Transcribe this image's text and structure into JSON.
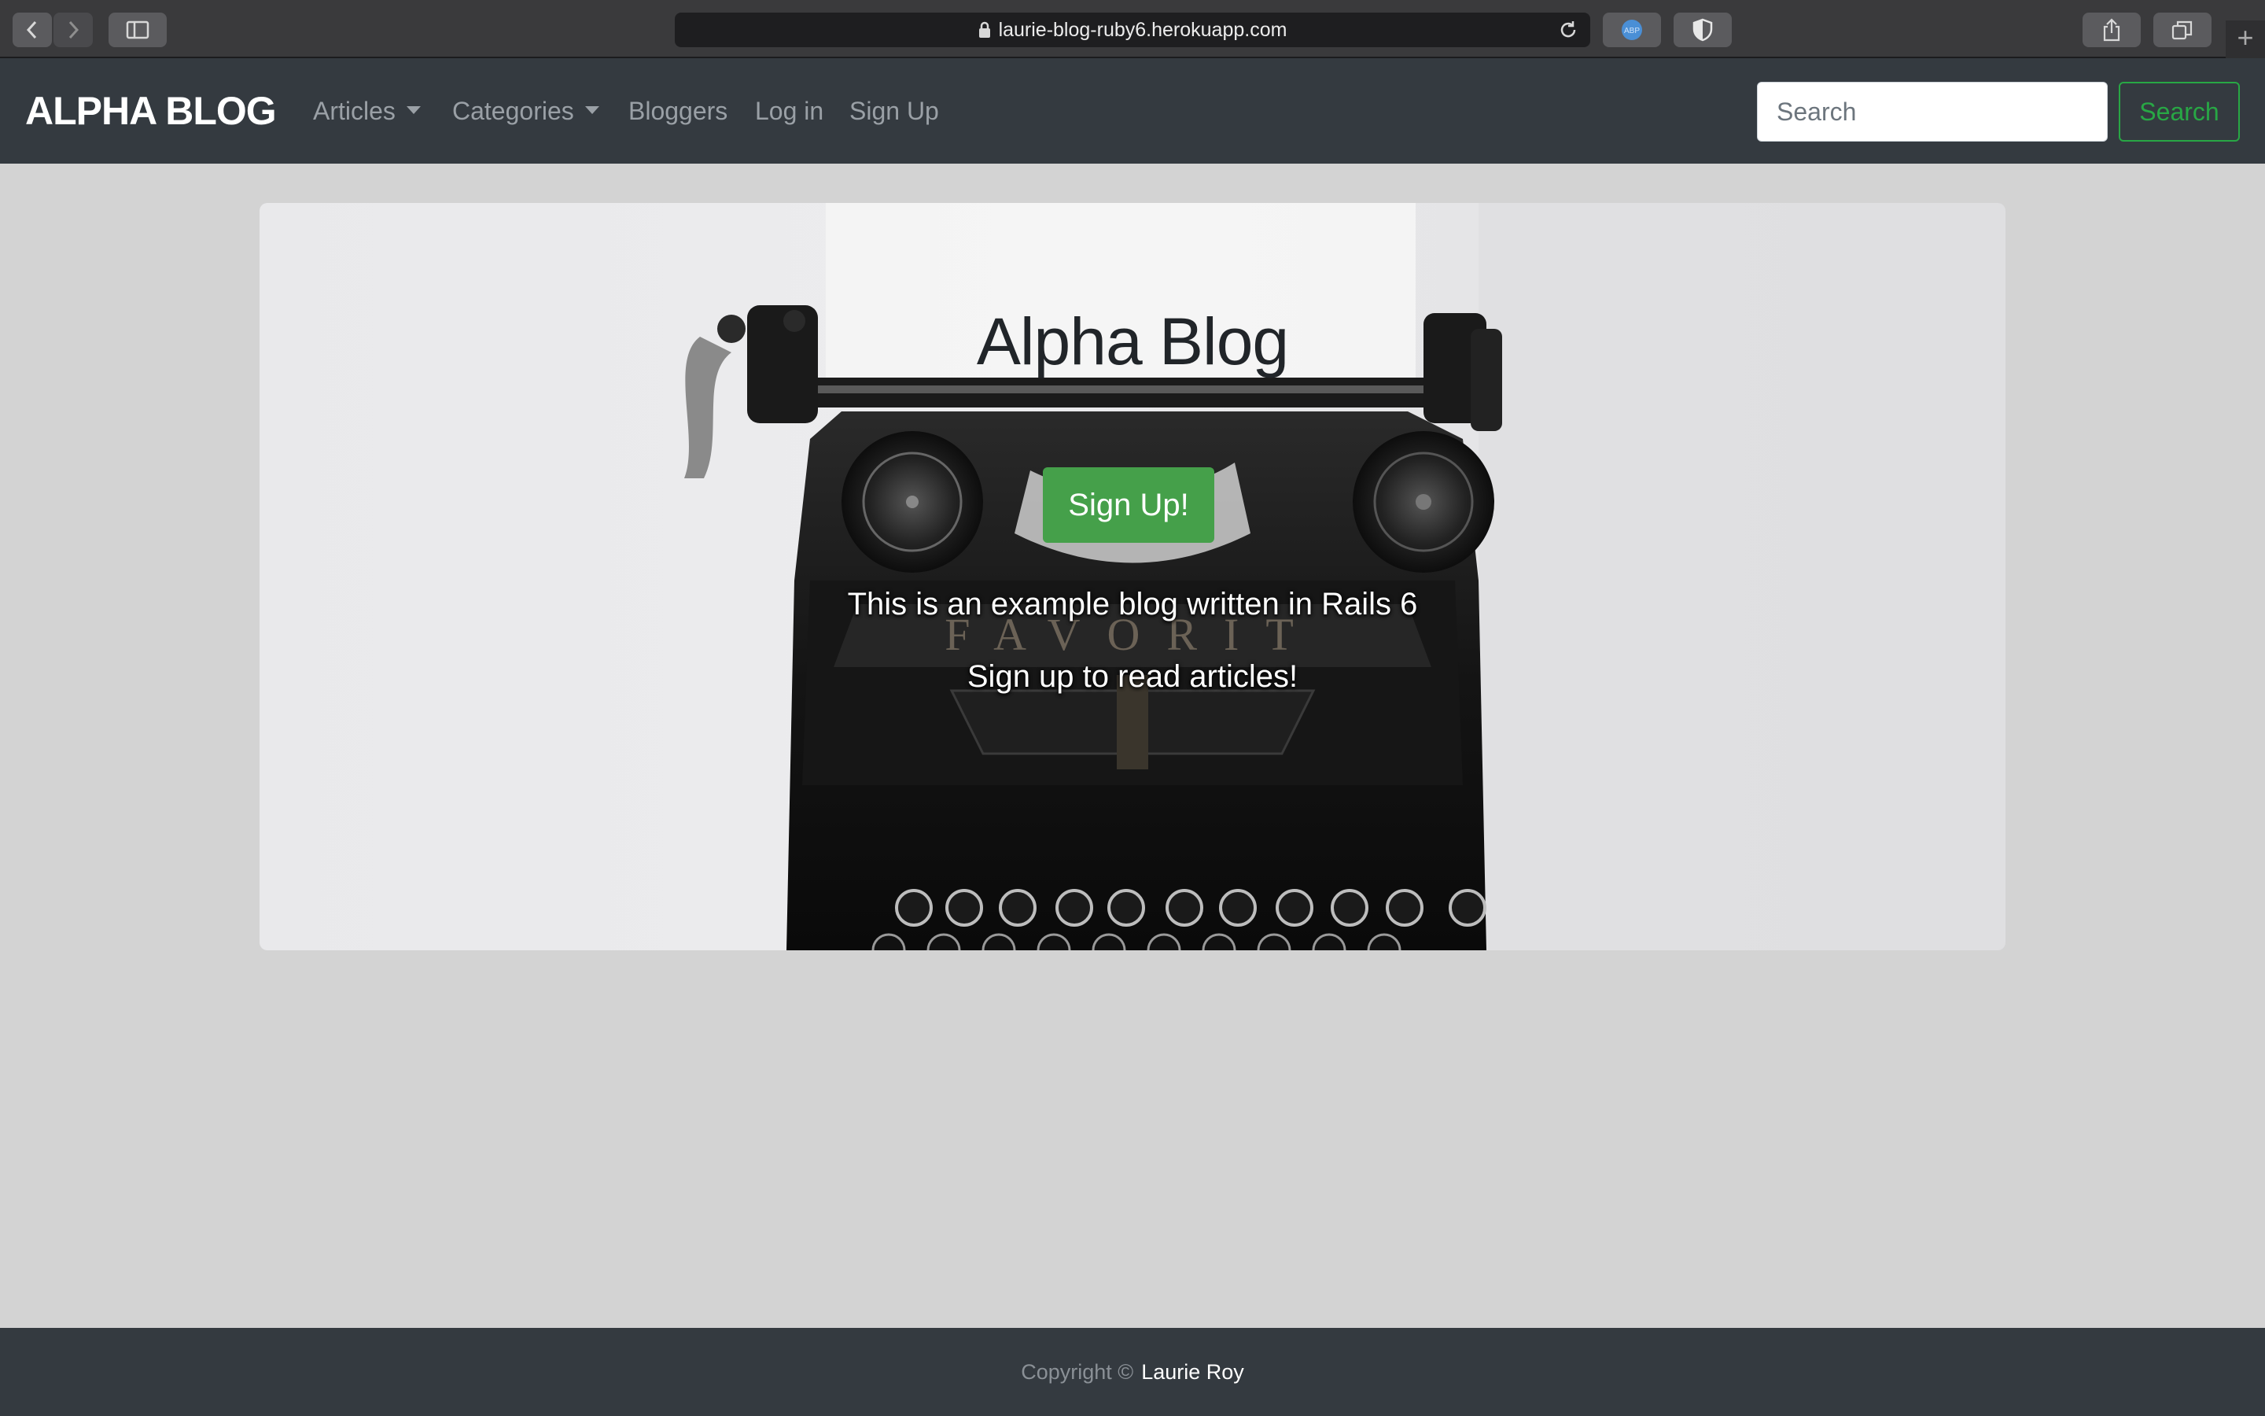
{
  "browser": {
    "url": "laurie-blog-ruby6.herokuapp.com",
    "icons": [
      "back-icon",
      "forward-icon",
      "sidebar-icon",
      "lock-icon",
      "reload-icon",
      "adblock-icon",
      "shield-icon",
      "share-icon",
      "tabs-icon",
      "plus-icon"
    ]
  },
  "navbar": {
    "brand": "ALPHA BLOG",
    "items": [
      {
        "label": "Articles",
        "dropdown": true
      },
      {
        "label": "Categories",
        "dropdown": true
      },
      {
        "label": "Bloggers",
        "dropdown": false
      },
      {
        "label": "Log in",
        "dropdown": false
      },
      {
        "label": "Sign Up",
        "dropdown": false
      }
    ],
    "search": {
      "placeholder": "Search",
      "value": "",
      "button_label": "Search"
    }
  },
  "hero": {
    "title": "Alpha Blog",
    "cta_label": "Sign Up!",
    "line1": "This is an example blog written in Rails 6",
    "line2": "Sign up to read articles!"
  },
  "footer": {
    "prefix": "Copyright ©",
    "author": "Laurie Roy"
  },
  "colors": {
    "navbar_bg": "#343a40",
    "page_bg": "#d3d3d3",
    "success": "#28a745",
    "cta_bg": "#45a04a"
  }
}
